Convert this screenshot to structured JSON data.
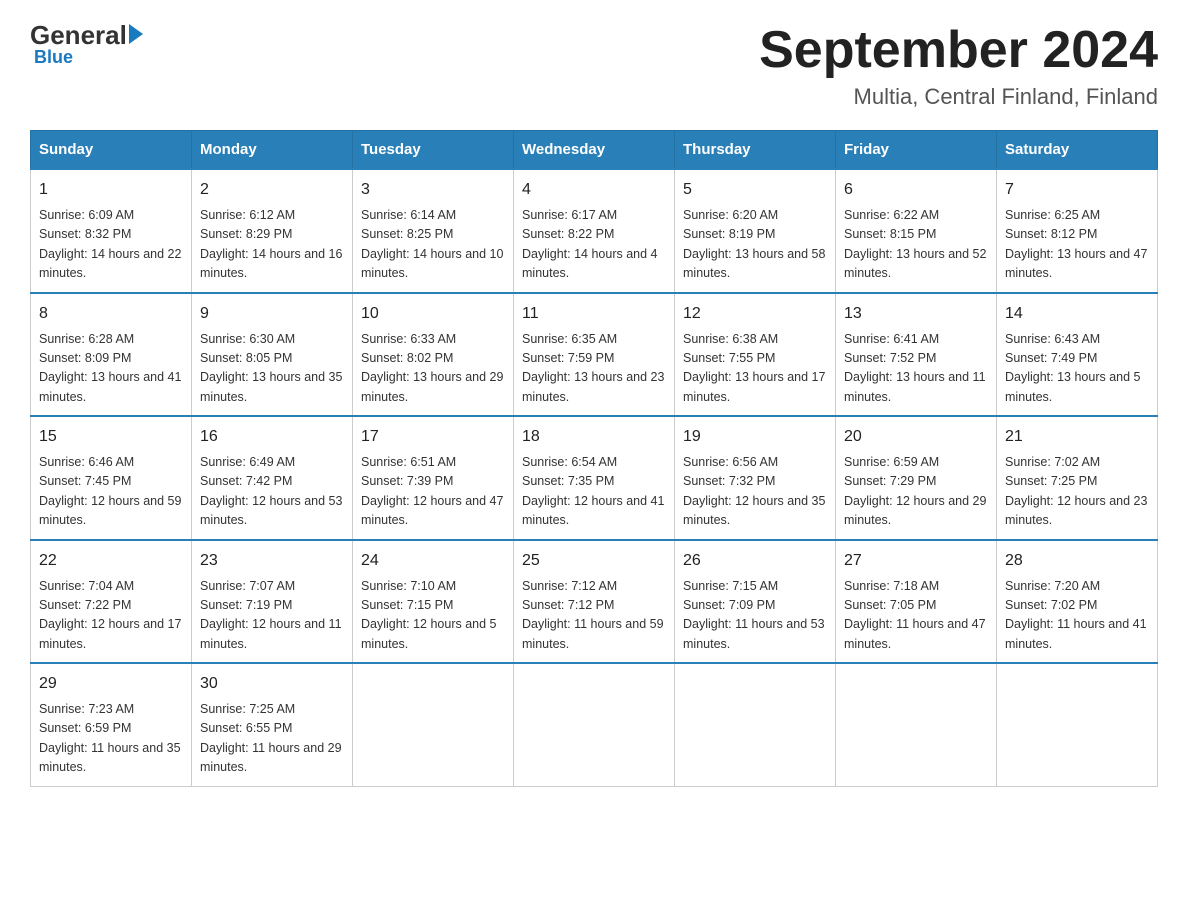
{
  "logo": {
    "general": "General",
    "blue": "Blue"
  },
  "header": {
    "month": "September 2024",
    "location": "Multia, Central Finland, Finland"
  },
  "days_of_week": [
    "Sunday",
    "Monday",
    "Tuesday",
    "Wednesday",
    "Thursday",
    "Friday",
    "Saturday"
  ],
  "weeks": [
    [
      {
        "day": "1",
        "sunrise": "Sunrise: 6:09 AM",
        "sunset": "Sunset: 8:32 PM",
        "daylight": "Daylight: 14 hours and 22 minutes."
      },
      {
        "day": "2",
        "sunrise": "Sunrise: 6:12 AM",
        "sunset": "Sunset: 8:29 PM",
        "daylight": "Daylight: 14 hours and 16 minutes."
      },
      {
        "day": "3",
        "sunrise": "Sunrise: 6:14 AM",
        "sunset": "Sunset: 8:25 PM",
        "daylight": "Daylight: 14 hours and 10 minutes."
      },
      {
        "day": "4",
        "sunrise": "Sunrise: 6:17 AM",
        "sunset": "Sunset: 8:22 PM",
        "daylight": "Daylight: 14 hours and 4 minutes."
      },
      {
        "day": "5",
        "sunrise": "Sunrise: 6:20 AM",
        "sunset": "Sunset: 8:19 PM",
        "daylight": "Daylight: 13 hours and 58 minutes."
      },
      {
        "day": "6",
        "sunrise": "Sunrise: 6:22 AM",
        "sunset": "Sunset: 8:15 PM",
        "daylight": "Daylight: 13 hours and 52 minutes."
      },
      {
        "day": "7",
        "sunrise": "Sunrise: 6:25 AM",
        "sunset": "Sunset: 8:12 PM",
        "daylight": "Daylight: 13 hours and 47 minutes."
      }
    ],
    [
      {
        "day": "8",
        "sunrise": "Sunrise: 6:28 AM",
        "sunset": "Sunset: 8:09 PM",
        "daylight": "Daylight: 13 hours and 41 minutes."
      },
      {
        "day": "9",
        "sunrise": "Sunrise: 6:30 AM",
        "sunset": "Sunset: 8:05 PM",
        "daylight": "Daylight: 13 hours and 35 minutes."
      },
      {
        "day": "10",
        "sunrise": "Sunrise: 6:33 AM",
        "sunset": "Sunset: 8:02 PM",
        "daylight": "Daylight: 13 hours and 29 minutes."
      },
      {
        "day": "11",
        "sunrise": "Sunrise: 6:35 AM",
        "sunset": "Sunset: 7:59 PM",
        "daylight": "Daylight: 13 hours and 23 minutes."
      },
      {
        "day": "12",
        "sunrise": "Sunrise: 6:38 AM",
        "sunset": "Sunset: 7:55 PM",
        "daylight": "Daylight: 13 hours and 17 minutes."
      },
      {
        "day": "13",
        "sunrise": "Sunrise: 6:41 AM",
        "sunset": "Sunset: 7:52 PM",
        "daylight": "Daylight: 13 hours and 11 minutes."
      },
      {
        "day": "14",
        "sunrise": "Sunrise: 6:43 AM",
        "sunset": "Sunset: 7:49 PM",
        "daylight": "Daylight: 13 hours and 5 minutes."
      }
    ],
    [
      {
        "day": "15",
        "sunrise": "Sunrise: 6:46 AM",
        "sunset": "Sunset: 7:45 PM",
        "daylight": "Daylight: 12 hours and 59 minutes."
      },
      {
        "day": "16",
        "sunrise": "Sunrise: 6:49 AM",
        "sunset": "Sunset: 7:42 PM",
        "daylight": "Daylight: 12 hours and 53 minutes."
      },
      {
        "day": "17",
        "sunrise": "Sunrise: 6:51 AM",
        "sunset": "Sunset: 7:39 PM",
        "daylight": "Daylight: 12 hours and 47 minutes."
      },
      {
        "day": "18",
        "sunrise": "Sunrise: 6:54 AM",
        "sunset": "Sunset: 7:35 PM",
        "daylight": "Daylight: 12 hours and 41 minutes."
      },
      {
        "day": "19",
        "sunrise": "Sunrise: 6:56 AM",
        "sunset": "Sunset: 7:32 PM",
        "daylight": "Daylight: 12 hours and 35 minutes."
      },
      {
        "day": "20",
        "sunrise": "Sunrise: 6:59 AM",
        "sunset": "Sunset: 7:29 PM",
        "daylight": "Daylight: 12 hours and 29 minutes."
      },
      {
        "day": "21",
        "sunrise": "Sunrise: 7:02 AM",
        "sunset": "Sunset: 7:25 PM",
        "daylight": "Daylight: 12 hours and 23 minutes."
      }
    ],
    [
      {
        "day": "22",
        "sunrise": "Sunrise: 7:04 AM",
        "sunset": "Sunset: 7:22 PM",
        "daylight": "Daylight: 12 hours and 17 minutes."
      },
      {
        "day": "23",
        "sunrise": "Sunrise: 7:07 AM",
        "sunset": "Sunset: 7:19 PM",
        "daylight": "Daylight: 12 hours and 11 minutes."
      },
      {
        "day": "24",
        "sunrise": "Sunrise: 7:10 AM",
        "sunset": "Sunset: 7:15 PM",
        "daylight": "Daylight: 12 hours and 5 minutes."
      },
      {
        "day": "25",
        "sunrise": "Sunrise: 7:12 AM",
        "sunset": "Sunset: 7:12 PM",
        "daylight": "Daylight: 11 hours and 59 minutes."
      },
      {
        "day": "26",
        "sunrise": "Sunrise: 7:15 AM",
        "sunset": "Sunset: 7:09 PM",
        "daylight": "Daylight: 11 hours and 53 minutes."
      },
      {
        "day": "27",
        "sunrise": "Sunrise: 7:18 AM",
        "sunset": "Sunset: 7:05 PM",
        "daylight": "Daylight: 11 hours and 47 minutes."
      },
      {
        "day": "28",
        "sunrise": "Sunrise: 7:20 AM",
        "sunset": "Sunset: 7:02 PM",
        "daylight": "Daylight: 11 hours and 41 minutes."
      }
    ],
    [
      {
        "day": "29",
        "sunrise": "Sunrise: 7:23 AM",
        "sunset": "Sunset: 6:59 PM",
        "daylight": "Daylight: 11 hours and 35 minutes."
      },
      {
        "day": "30",
        "sunrise": "Sunrise: 7:25 AM",
        "sunset": "Sunset: 6:55 PM",
        "daylight": "Daylight: 11 hours and 29 minutes."
      },
      {
        "day": "",
        "sunrise": "",
        "sunset": "",
        "daylight": ""
      },
      {
        "day": "",
        "sunrise": "",
        "sunset": "",
        "daylight": ""
      },
      {
        "day": "",
        "sunrise": "",
        "sunset": "",
        "daylight": ""
      },
      {
        "day": "",
        "sunrise": "",
        "sunset": "",
        "daylight": ""
      },
      {
        "day": "",
        "sunrise": "",
        "sunset": "",
        "daylight": ""
      }
    ]
  ]
}
